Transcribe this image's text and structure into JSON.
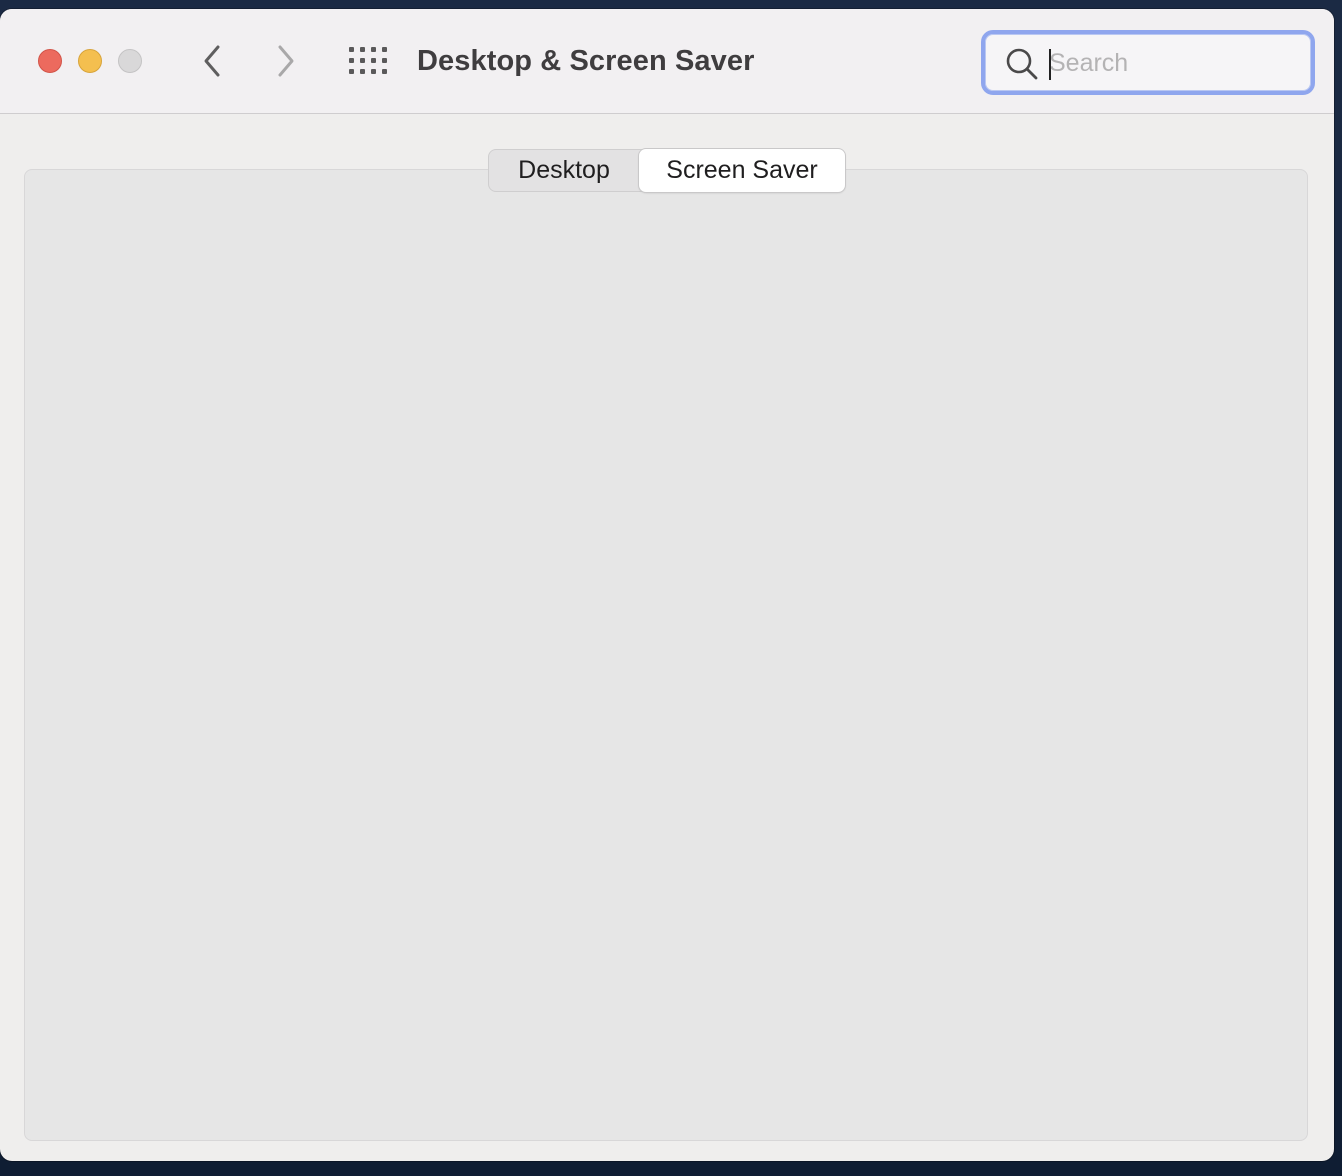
{
  "window": {
    "title": "Desktop & Screen Saver"
  },
  "toolbar": {
    "back_icon": "chevron-left-icon",
    "forward_icon": "chevron-right-icon",
    "grid_icon": "show-all-grid-icon"
  },
  "search": {
    "placeholder": "Search",
    "value": "",
    "icon": "search-icon",
    "focus_ring_color": "#8fa6ee"
  },
  "tabs": [
    {
      "label": "Desktop",
      "selected": false
    },
    {
      "label": "Screen Saver",
      "selected": true
    }
  ],
  "colors": {
    "close": "#ec6a5e",
    "minimize": "#f4bf4f",
    "zoom_inactive": "#d9d8d9"
  }
}
